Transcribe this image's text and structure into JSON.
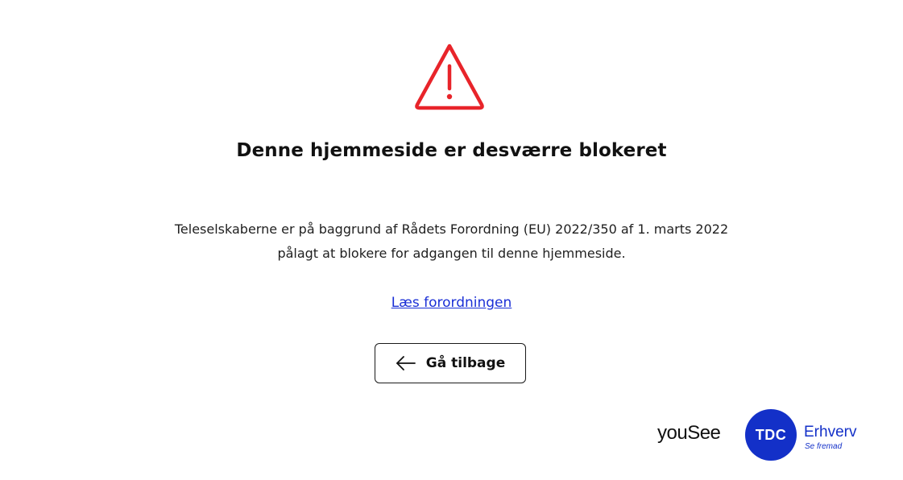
{
  "headline": "Denne hjemmeside er desværre blokeret",
  "body": {
    "line1": "Teleselskaberne er på baggrund af Rådets Forordning (EU) 2022/350 af 1. marts 2022",
    "line2": "pålagt at blokere for adgangen til denne hjemmeside."
  },
  "link": {
    "label": "Læs forordningen"
  },
  "back_button": {
    "label": "Gå tilbage",
    "icon": "arrow-left-icon"
  },
  "warning_icon": {
    "name": "warning-triangle-icon",
    "color": "#e8242a"
  },
  "logos": {
    "yousee": "youSee",
    "tdc": "TDC",
    "erhverv": "Erhverv",
    "tagline": "Se fremad",
    "brand_color": "#1330c8"
  }
}
